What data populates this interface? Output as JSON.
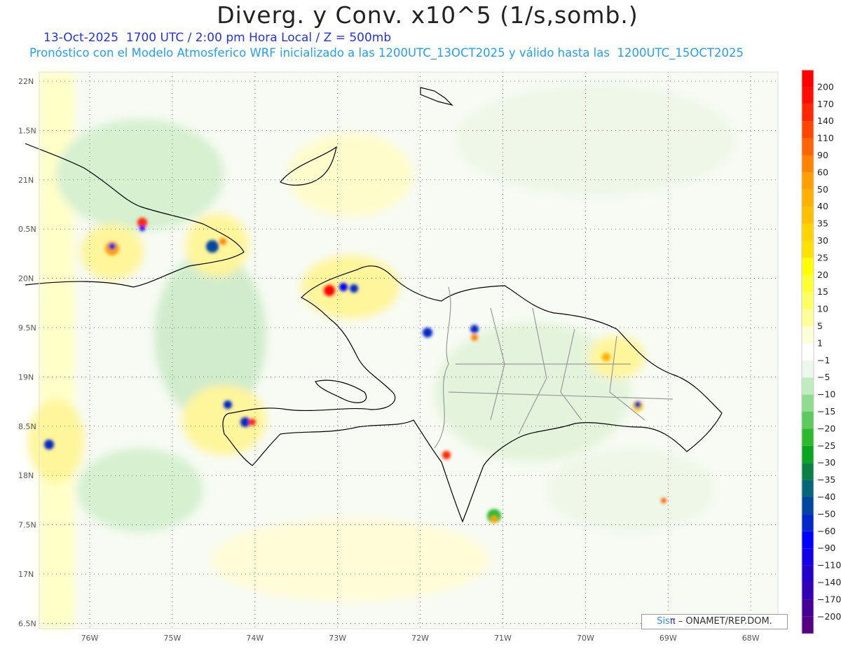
{
  "header": {
    "title": "Diverg. y Conv. x10^5 (1/s,somb.)",
    "line1": "13-Oct-2025  1700 UTC / 2:00 pm Hora Local / Z = 500mb",
    "line2": "Pronóstico con el Modelo Atmosferico WRF inicializado a las 1200UTC_13OCT2025 y válido hasta las  1200UTC_15OCT2025"
  },
  "map": {
    "lat_labels": [
      "22N",
      "1.5N",
      "21N",
      "0.5N",
      "20N",
      "9.5N",
      "19N",
      "8.5N",
      "18N",
      "7.5N",
      "17N",
      "6.5N"
    ],
    "lon_labels": [
      "76W",
      "75W",
      "74W",
      "73W",
      "72W",
      "71W",
      "70W",
      "69W",
      "68W"
    ]
  },
  "colorbar": {
    "labels": [
      "200",
      "170",
      "140",
      "110",
      "90",
      "60",
      "50",
      "40",
      "35",
      "30",
      "25",
      "20",
      "15",
      "10",
      "5",
      "1",
      "−1",
      "−5",
      "−10",
      "−15",
      "−20",
      "−25",
      "−30",
      "−35",
      "−40",
      "−50",
      "−60",
      "−90",
      "−110",
      "−140",
      "−170",
      "−200"
    ],
    "colors": [
      "#ff0000",
      "#ff0d00",
      "#ff2800",
      "#ff4600",
      "#ff6400",
      "#ff8200",
      "#ffa000",
      "#ffb000",
      "#ffc000",
      "#ffd200",
      "#ffe100",
      "#ffff00",
      "#ffff32",
      "#ffff64",
      "#ffff9a",
      "#ffffd8",
      "#ffffff",
      "#ebf8eb",
      "#c0ecc0",
      "#8fdc8f",
      "#5cca5c",
      "#2db92d",
      "#08a520",
      "#0a8045",
      "#066678",
      "#0046a0",
      "#0028c8",
      "#0000ff",
      "#1400e6",
      "#2400c8",
      "#3400b4",
      "#440096",
      "#560082"
    ]
  },
  "credit": {
    "sis": "Sis",
    "pi": "π",
    "text": " – ONAMET/REP.DOM."
  }
}
